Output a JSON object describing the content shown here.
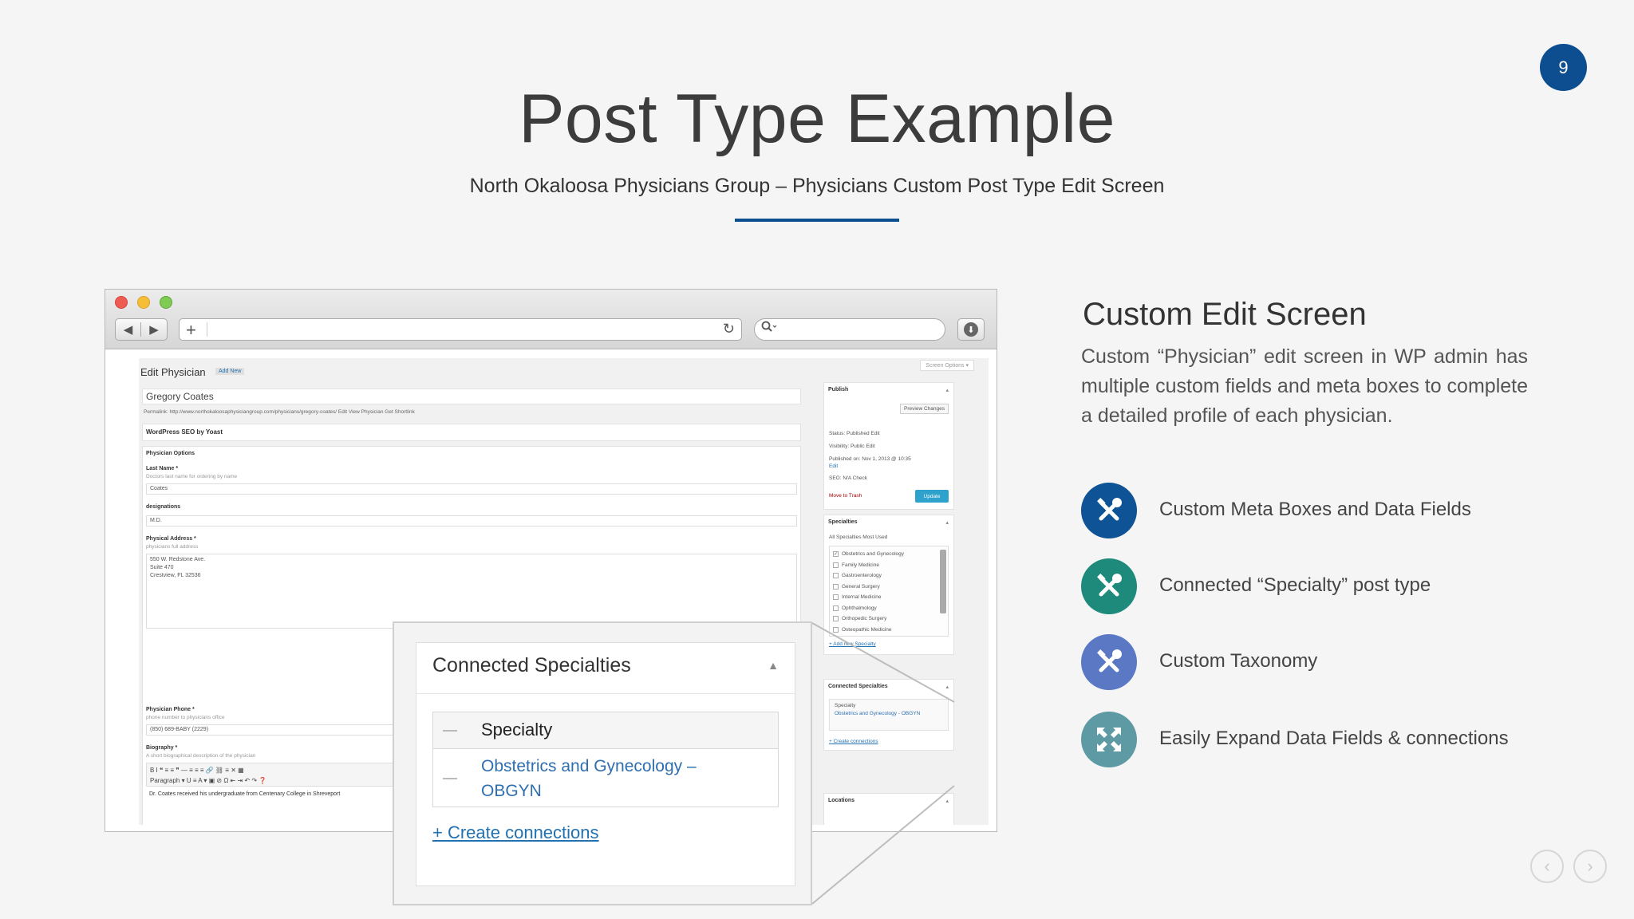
{
  "page_number": "9",
  "title": "Post Type Example",
  "subtitle": "North Okaloosa Physicians Group – Physicians Custom Post Type Edit Screen",
  "colors": {
    "accent": "#0c4e8f",
    "icon_blue": "#0e5395",
    "icon_teal": "#1d8a7c",
    "icon_periwinkle": "#5a78c4",
    "icon_slate_teal": "#5e9aa3"
  },
  "browser": {
    "reload_icon": "↻",
    "search_icon": "search-icon",
    "url_plus": "+"
  },
  "wp": {
    "edit_title": "Edit Physician",
    "add_new": "Add New",
    "screen_options": "Screen Options ▾",
    "post_name": "Gregory Coates",
    "permalink": "Permalink: http://www.northokaloosaphysiciangroup.com/physicians/gregory-coates/  Edit  View Physician  Get Shortlink",
    "seo_box": "WordPress SEO by Yoast",
    "options_box": "Physician Options",
    "last_name_label": "Last Name *",
    "last_name_hint": "Doctors last name for ordering by name",
    "last_name_value": "Coates",
    "designations_label": "designations",
    "designations_value": "M.D.",
    "address_label": "Physical Address *",
    "address_hint": "physicians full address",
    "address_lines": [
      "550 W. Redstone Ave.",
      "Suite 470",
      "Crestview, FL 32536"
    ],
    "phone_label": "Physician Phone *",
    "phone_hint": "phone number to physicians office",
    "phone_value": "(850) 689-BABY (2229)",
    "bio_label": "Biography *",
    "bio_hint": "A short biographical description of the physician",
    "editor_row1": "B  I  ❝  ≡  ≡  ❞  —  ≡  ≡  ≡  🔗  ⛓  ≡  ✕  ▦",
    "editor_row2": "Paragraph ▾  U  ≡  A ▾  ▣  ⊘  Ω  ⇤  ⇥  ↶  ↷  ❓",
    "bio_start": "Dr. Coates received his undergraduate from Centenary College in Shreveport",
    "publish": {
      "title": "Publish",
      "preview": "Preview Changes",
      "status": "Status: Published Edit",
      "visibility": "Visibility: Public Edit",
      "published_on": "Published on: Nov 1, 2013 @ 10:35",
      "published_edit": "Edit",
      "seo": "SEO: N/A Check",
      "trash": "Move to Trash",
      "update": "Update"
    },
    "specialties": {
      "title": "Specialties",
      "tabs": "All Specialties    Most Used",
      "items": [
        "Obstetrics and Gynecology",
        "Family Medicine",
        "Gastroenterology",
        "General Surgery",
        "Internal Medicine",
        "Ophthalmology",
        "Orthopedic Surgery",
        "Osteopathic Medicine"
      ],
      "add_new": "+ Add new Specialty"
    },
    "connected_small": {
      "title": "Connected Specialties",
      "col": "Specialty",
      "value": "Obstetrics and Gynecology - OBGYN",
      "create": "+ Create connections"
    },
    "locations": {
      "title": "Locations"
    }
  },
  "zoom": {
    "panel_title": "Connected Specialties",
    "column_label": "Specialty",
    "row_value": "Obstetrics and Gynecology – OBGYN",
    "create_link": "+ Create connections"
  },
  "feature": {
    "heading": "Custom Edit Screen",
    "description": "Custom “Physician” edit screen in WP admin has multiple custom fields and meta boxes to complete a detailed profile of each physician.",
    "items": [
      {
        "label": "Custom Meta Boxes and Data Fields",
        "icon": "tools-icon"
      },
      {
        "label": "Connected “Specialty” post type",
        "icon": "tools-icon"
      },
      {
        "label": "Custom Taxonomy",
        "icon": "tools-icon"
      },
      {
        "label": "Easily Expand Data Fields & connections",
        "icon": "expand-icon"
      }
    ]
  },
  "nav": {
    "prev": "‹",
    "next": "›"
  }
}
